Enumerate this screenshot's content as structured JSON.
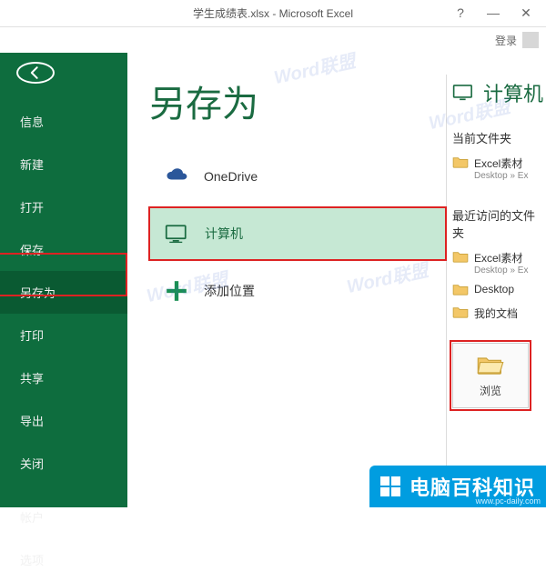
{
  "titlebar": {
    "title": "学生成绩表.xlsx - Microsoft Excel",
    "help": "?",
    "minimize": "—",
    "close": "✕"
  },
  "login": {
    "label": "登录"
  },
  "sidebar": {
    "items": [
      {
        "label": "信息"
      },
      {
        "label": "新建"
      },
      {
        "label": "打开"
      },
      {
        "label": "保存"
      },
      {
        "label": "另存为"
      },
      {
        "label": "打印"
      },
      {
        "label": "共享"
      },
      {
        "label": "导出"
      },
      {
        "label": "关闭"
      },
      {
        "label": "帐户"
      },
      {
        "label": "选项"
      }
    ]
  },
  "page": {
    "title": "另存为",
    "locations": [
      {
        "label": "OneDrive"
      },
      {
        "label": "计算机"
      },
      {
        "label": "添加位置"
      }
    ]
  },
  "rightpane": {
    "header": "计算机",
    "current_section": "当前文件夹",
    "recent_section": "最近访问的文件夹",
    "current": [
      {
        "name": "Excel素材",
        "path": "Desktop » Ex"
      }
    ],
    "recent": [
      {
        "name": "Excel素材",
        "path": "Desktop » Ex"
      },
      {
        "name": "Desktop",
        "path": ""
      },
      {
        "name": "我的文档",
        "path": ""
      }
    ],
    "browse": "浏览"
  },
  "watermark": {
    "banner": "电脑百科知识",
    "url": "www.pc-daily.com",
    "ghost": "Word联盟"
  }
}
